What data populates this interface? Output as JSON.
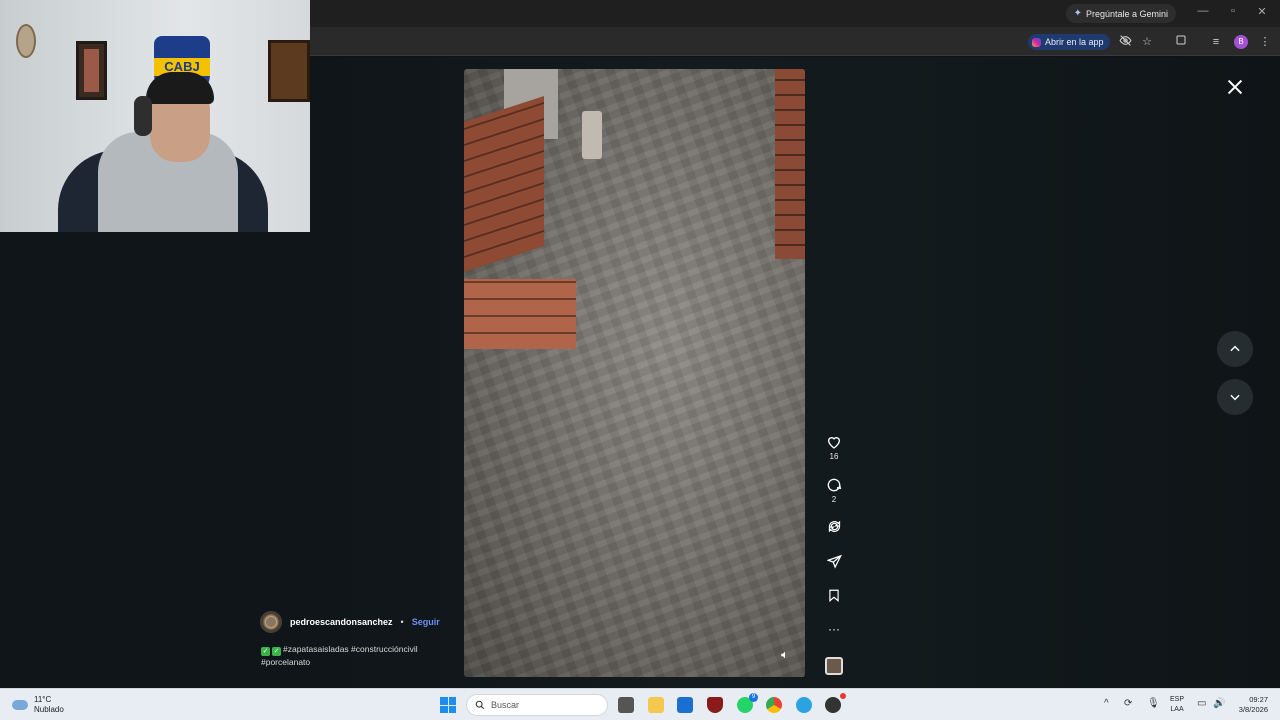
{
  "browser": {
    "gemini_label": "Pregúntale a Gemini",
    "open_app_label": "Abrir en la app",
    "profile_initial": "B"
  },
  "post": {
    "author": "pedroescandonsanchez",
    "separator": "•",
    "follow_label": "Seguir",
    "caption_line1": "#zapatasaisladas #construccióncivil",
    "caption_line2": "#porcelanato",
    "likes": "16",
    "comments": "2"
  },
  "webcam": {
    "crest_text": "CABJ"
  },
  "taskbar": {
    "weather_temp": "11°C",
    "weather_desc": "Nublado",
    "search_placeholder": "Buscar",
    "whatsapp_badge": "9",
    "lang_line1": "ESP",
    "lang_line2": "LAA",
    "time": "09:27",
    "date": "3/8/2026"
  },
  "colors": {
    "accent_follow": "#6f8ff6",
    "page_bg": "#0e1316",
    "open_app_bg": "#1e3a6e"
  },
  "icons": [
    "heart-icon",
    "comment-icon",
    "repost-icon",
    "share-icon",
    "bookmark-icon",
    "more-icon",
    "close-icon",
    "chevron-up-icon",
    "chevron-down-icon",
    "sound-icon"
  ]
}
